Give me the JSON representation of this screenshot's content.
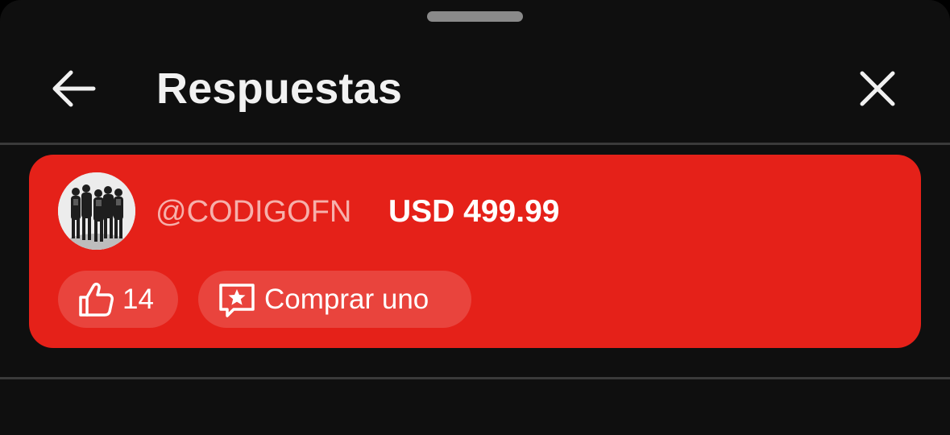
{
  "header": {
    "title": "Respuestas",
    "back_icon": "arrow-left-icon",
    "close_icon": "close-icon"
  },
  "comment": {
    "handle": "@CODIGOFN",
    "amount": "USD 499.99",
    "likes": "14",
    "buy_label": "Comprar uno",
    "like_icon": "thumbs-up-icon",
    "buy_icon": "star-chat-icon",
    "card_color": "#e52119",
    "handle_color": "#f6b0ab"
  },
  "theme": {
    "background": "#0f0f0f",
    "text": "#f1f1f1"
  }
}
